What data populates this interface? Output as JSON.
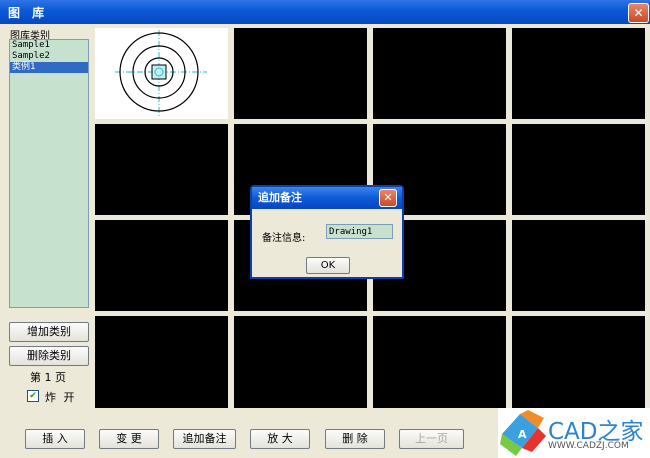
{
  "window": {
    "title": "图 库"
  },
  "sidebar": {
    "category_label": "图库类别",
    "categories": [
      {
        "label": "Sample1",
        "selected": false
      },
      {
        "label": "Sample2",
        "selected": false
      },
      {
        "label": "类例1",
        "selected": true
      }
    ],
    "add_category": "增加类别",
    "delete_category": "删除类别",
    "page_indicator": "第 1 页",
    "explode_checkbox": {
      "label": "炸 开",
      "checked": true
    }
  },
  "grid": {
    "rows": 4,
    "cols": 4,
    "thumbnail_background": "#000000",
    "selected_cell_background": "#ffffff"
  },
  "toolbar": {
    "insert": "插 入",
    "change": "变 更",
    "add_note": "追加备注",
    "zoom": "放 大",
    "delete": "删 除",
    "prev_page": "上一页"
  },
  "dialog": {
    "title": "追加备注",
    "note_label": "备注信息:",
    "note_value": "Drawing1",
    "ok": "OK"
  },
  "watermark": {
    "brand": "CAD之家",
    "url": "WWW.CADZJ.COM"
  }
}
